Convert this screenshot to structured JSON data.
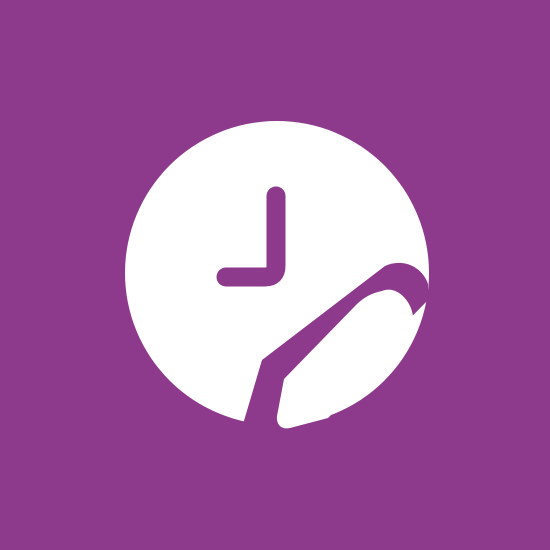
{
  "app_icon": {
    "icon": "clock-edit-icon",
    "glyphs": [
      "clock-icon",
      "pencil-icon"
    ],
    "colors": {
      "background": "#8E3A8C",
      "foreground": "#FFFFFF"
    }
  }
}
